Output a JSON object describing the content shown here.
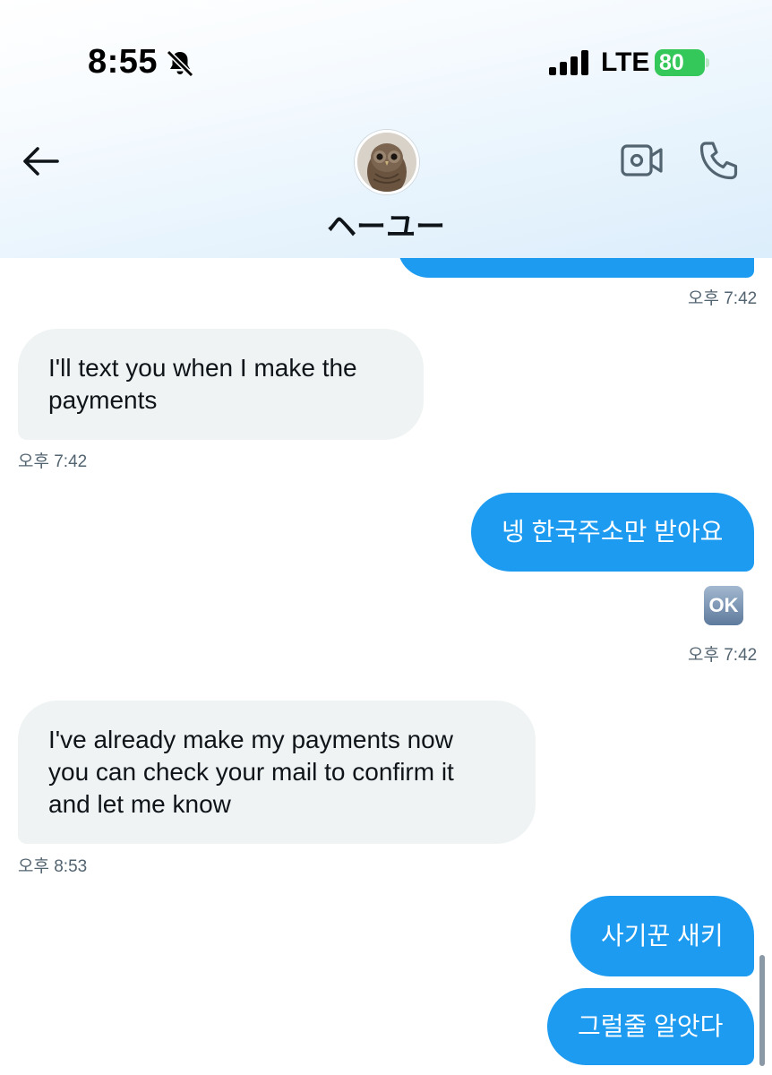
{
  "status_bar": {
    "time": "8:55",
    "network": "LTE",
    "battery": "80"
  },
  "header": {
    "contact_name": "ヘーユー",
    "back_icon": "arrow-left-icon",
    "video_icon": "video-camera-icon",
    "phone_icon": "phone-icon",
    "avatar_icon": "owl-avatar"
  },
  "messages": [
    {
      "direction": "out",
      "text": "",
      "time": "오후 7:42"
    },
    {
      "direction": "in",
      "text": "I'll text you when I make the payments",
      "line1": "I'll text you when I make the",
      "line2": "payments",
      "time": "오후 7:42"
    },
    {
      "direction": "out",
      "text": "넹 한국주소만 받아요",
      "reaction": "OK",
      "time": "오후 7:42"
    },
    {
      "direction": "in",
      "text": "I've already make my payments now you can check your mail to confirm it and let me know",
      "line1": "I've already make my payments now",
      "line2": "you can check your mail to confirm it",
      "line3": "and let me know",
      "time": "오후 8:53"
    },
    {
      "direction": "out",
      "text": "사기꾼 새키"
    },
    {
      "direction": "out",
      "text": "그럴줄 알앗다"
    }
  ],
  "colors": {
    "outgoing_bubble": "#1d9bf0",
    "incoming_bubble": "#eff3f4",
    "battery": "#34c759"
  }
}
